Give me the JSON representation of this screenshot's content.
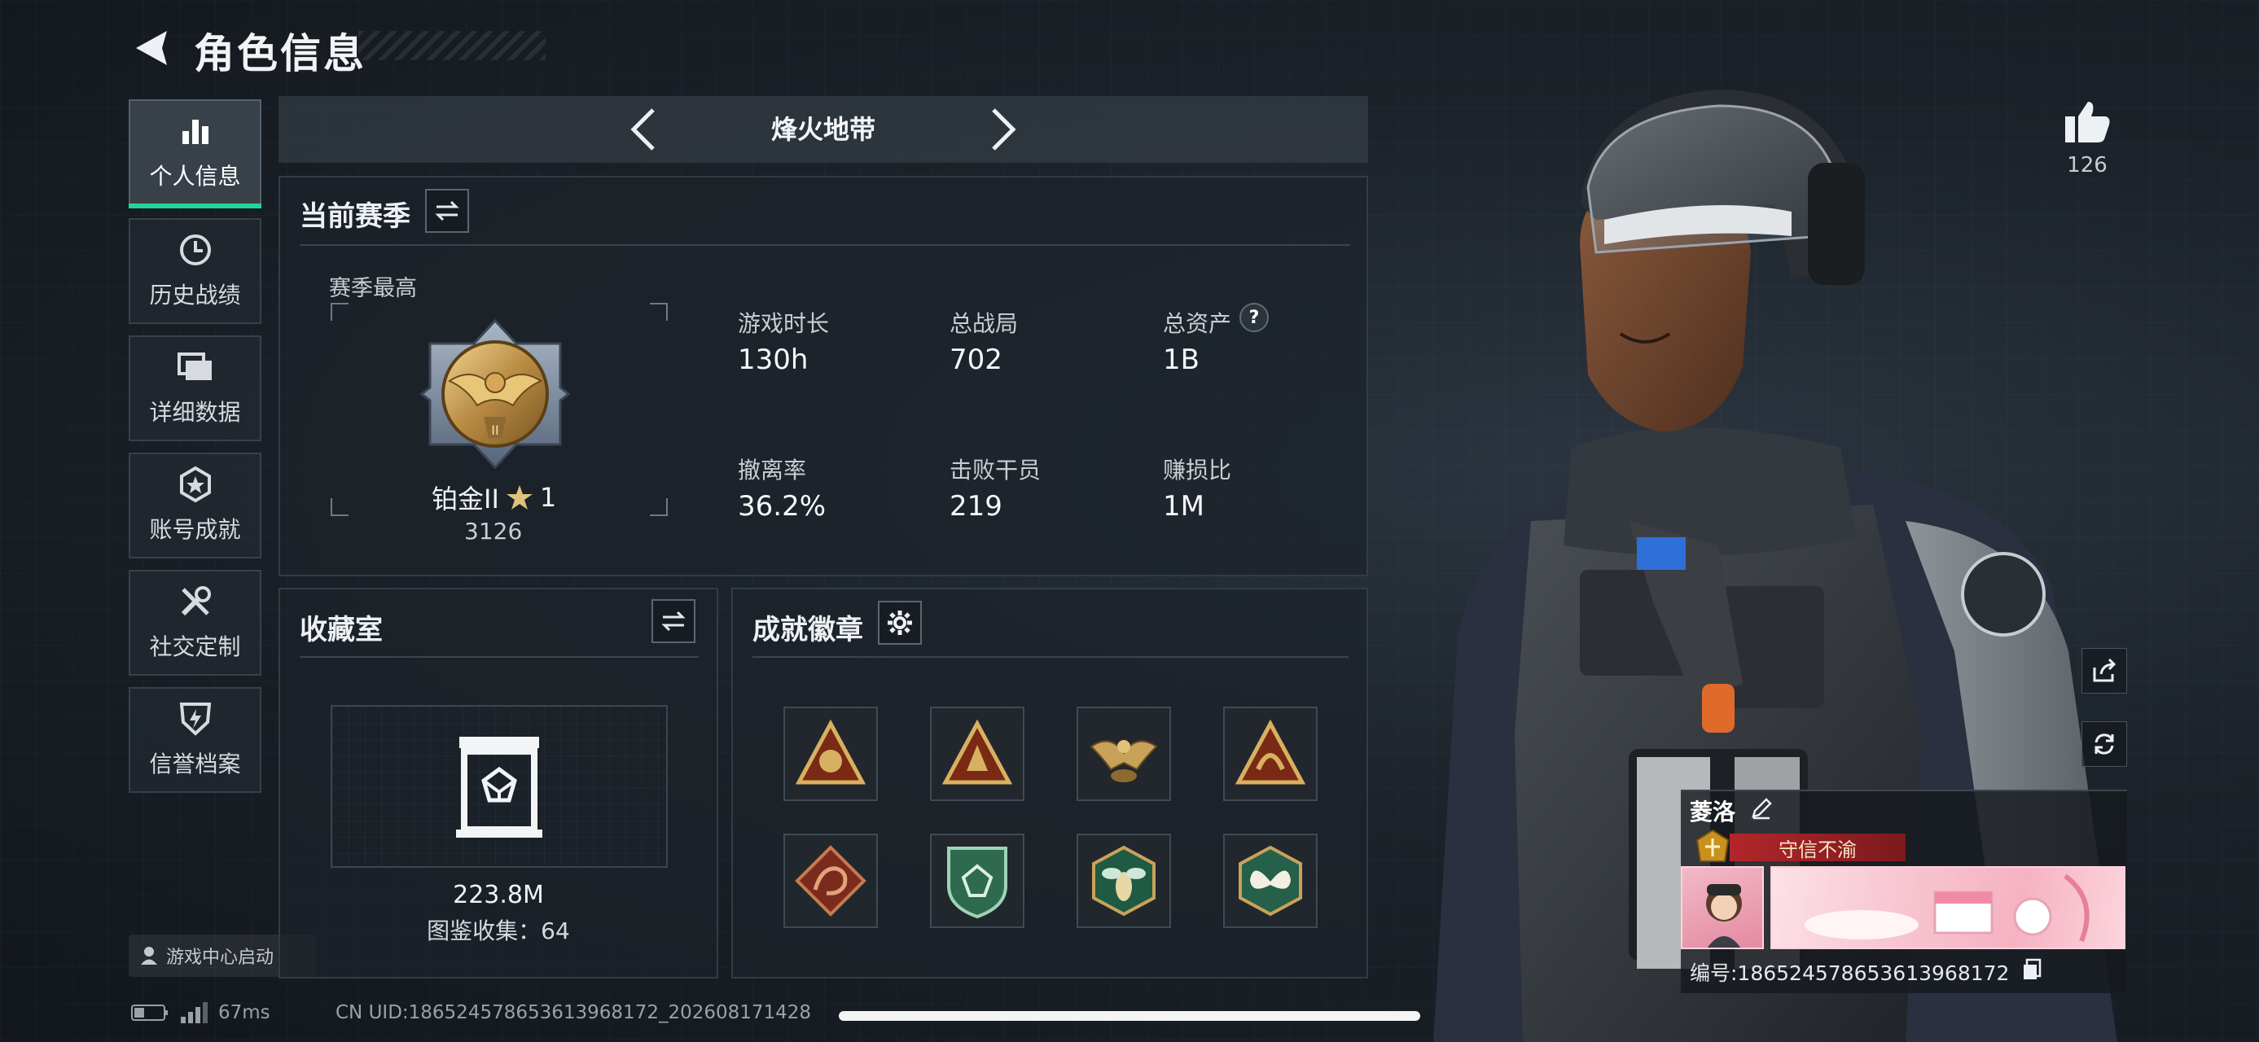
{
  "header": {
    "title": "角色信息"
  },
  "nav": {
    "items": [
      {
        "label": "个人信息",
        "icon": "bar-chart-icon",
        "active": true
      },
      {
        "label": "历史战绩",
        "icon": "clock-icon"
      },
      {
        "label": "详细数据",
        "icon": "folder-icon"
      },
      {
        "label": "账号成就",
        "icon": "medal-icon"
      },
      {
        "label": "社交定制",
        "icon": "tools-icon"
      },
      {
        "label": "信誉档案",
        "icon": "shield-icon"
      }
    ],
    "launch_label": "游戏中心启动"
  },
  "mode": {
    "label": "烽火地带"
  },
  "season": {
    "title": "当前赛季",
    "best_label": "赛季最高",
    "rank_name": "铂金II",
    "stars": "1",
    "score": "3126",
    "stats": [
      {
        "label": "游戏时长",
        "value": "130h"
      },
      {
        "label": "总战局",
        "value": "702"
      },
      {
        "label": "总资产",
        "value": "1B",
        "help": "?"
      },
      {
        "label": "撤离率",
        "value": "36.2%"
      },
      {
        "label": "击败干员",
        "value": "219"
      },
      {
        "label": "赚损比",
        "value": "1M"
      }
    ]
  },
  "collection": {
    "title": "收藏室",
    "value": "223.8M",
    "collect_label": "图鉴收集：64"
  },
  "achievements": {
    "title": "成就徽章",
    "badges": [
      "triangle-badge-gold-1",
      "triangle-badge-gold-2",
      "eagle-badge-gold",
      "triangle-badge-gold-3",
      "dragon-badge-red",
      "shield-badge-green",
      "wasp-badge-green",
      "butterfly-badge-green"
    ]
  },
  "profile": {
    "like_count": "126",
    "name": "菱洛",
    "honor_title": "守信不渝",
    "id_text": "编号:18652457865361396817​2"
  },
  "status": {
    "ping": "67ms",
    "uid": "CN UID:18652457865361396817​2_202608171428"
  },
  "colors": {
    "accent": "#23d49a",
    "gold": "#c9a25a",
    "title_red": "#b3262a"
  }
}
